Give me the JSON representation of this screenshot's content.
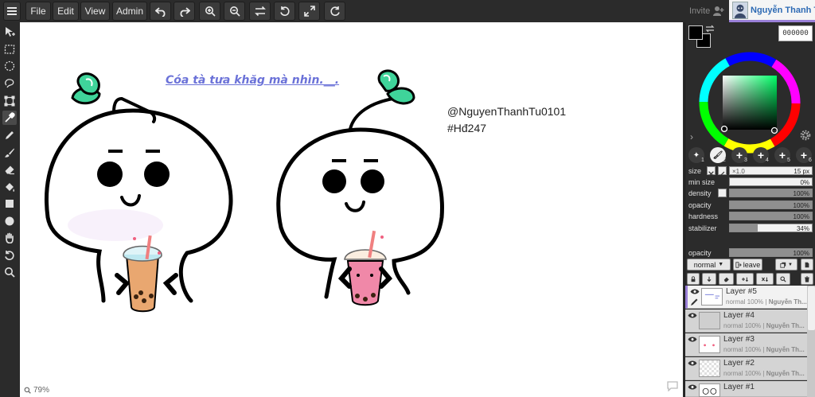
{
  "menu": {
    "file": "File",
    "edit": "Edit",
    "view": "View",
    "admin": "Admin"
  },
  "header": {
    "invite": "Invite",
    "user_name": "Nguyễn Thanh Tú"
  },
  "canvas": {
    "handwritten_text": "Cóa tà tưa khăg mà nhìn.__.",
    "watermark_line1": "@NguyenThanhTu0101",
    "watermark_line2": "#Hđ247",
    "zoom": "79%"
  },
  "colors": {
    "hex": "000000",
    "primary": "#000000",
    "secondary": "#000000",
    "accent": "#9a80d8"
  },
  "brushes": [
    {
      "num": "1",
      "glyph": "✦"
    },
    {
      "num": "2",
      "glyph": "🖌"
    },
    {
      "num": "3",
      "glyph": "+"
    },
    {
      "num": "4",
      "glyph": "+"
    },
    {
      "num": "5",
      "glyph": "+"
    },
    {
      "num": "6",
      "glyph": "+"
    }
  ],
  "brush_props": {
    "size_label": "size",
    "size_mult": "×1.0",
    "size_value": "15 px",
    "min_size_label": "min size",
    "min_size_value": "0%",
    "min_size_level": 0,
    "density_label": "density",
    "density_value": "100%",
    "density_level": 100,
    "opacity_label": "opacity",
    "opacity_value": "100%",
    "opacity_level": 100,
    "hardness_label": "hardness",
    "hardness_value": "100%",
    "hardness_level": 100,
    "stabilizer_label": "stabilizer",
    "stabilizer_value": "34%",
    "stabilizer_level": 34
  },
  "layer_props": {
    "opacity_label": "opacity",
    "opacity_value": "100%",
    "opacity_level": 100,
    "blend_mode": "normal",
    "leave_label": "leave"
  },
  "layers": [
    {
      "name": "Layer #5",
      "mode": "normal",
      "opacity": "100%",
      "owner": "Nguyễn Th..."
    },
    {
      "name": "Layer #4",
      "mode": "normal",
      "opacity": "100%",
      "owner": "Nguyễn Th..."
    },
    {
      "name": "Layer #3",
      "mode": "normal",
      "opacity": "100%",
      "owner": "Nguyễn Th..."
    },
    {
      "name": "Layer #2",
      "mode": "normal",
      "opacity": "100%",
      "owner": "Nguyễn Th..."
    },
    {
      "name": "Layer #1",
      "mode": "normal",
      "opacity": "100%",
      "owner": "Nguyễn Th..."
    }
  ]
}
